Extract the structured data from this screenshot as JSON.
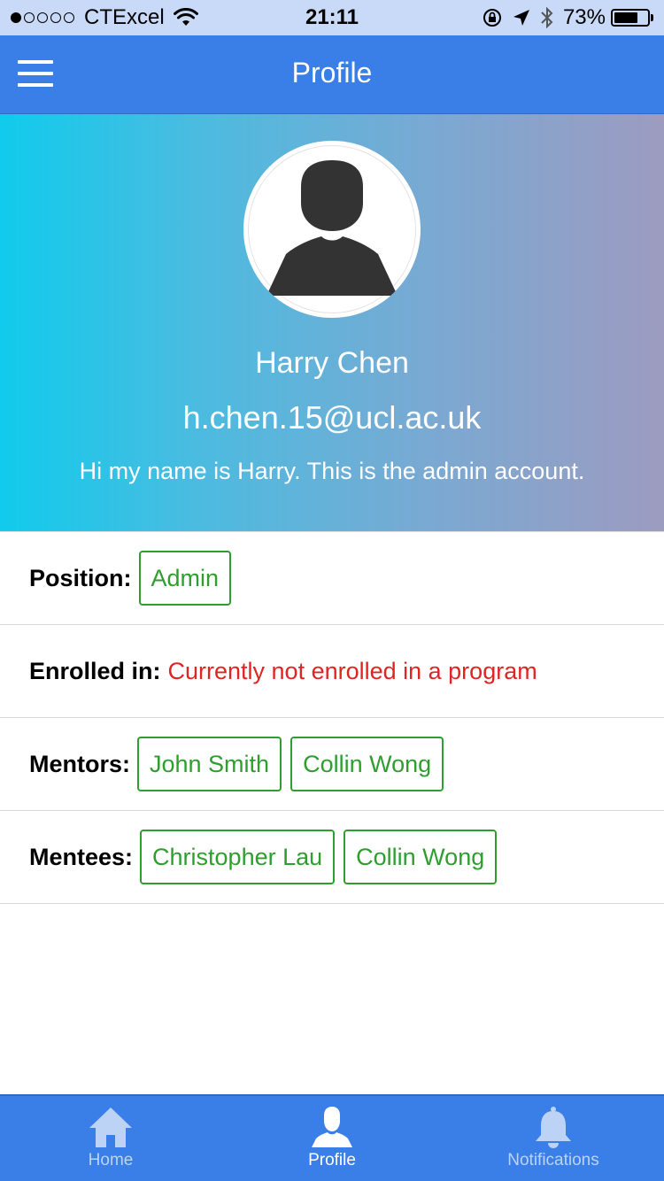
{
  "status_bar": {
    "carrier": "CTExcel",
    "time": "21:11",
    "battery_percent": "73%",
    "battery_level": 0.73,
    "signal_strength": 1,
    "signal_dots_total": 5
  },
  "header": {
    "title": "Profile",
    "menu_icon": "hamburger-menu-icon"
  },
  "profile": {
    "name": "Harry Chen",
    "email": "h.chen.15@ucl.ac.uk",
    "bio": "Hi my name is Harry. This is the admin account.",
    "avatar_icon": "default-user-avatar-icon"
  },
  "details": {
    "position": {
      "label": "Position:",
      "tags": [
        "Admin"
      ]
    },
    "enrolled": {
      "label": "Enrolled in:",
      "status": "Currently not enrolled in a program"
    },
    "mentors": {
      "label": "Mentors:",
      "tags": [
        "John Smith",
        "Collin Wong"
      ]
    },
    "mentees": {
      "label": "Mentees:",
      "tags": [
        "Christopher Lau",
        "Collin Wong"
      ]
    }
  },
  "tab_bar": {
    "items": [
      {
        "label": "Home",
        "icon": "home-icon",
        "active": false
      },
      {
        "label": "Profile",
        "icon": "person-icon",
        "active": true
      },
      {
        "label": "Notifications",
        "icon": "bell-icon",
        "active": false
      }
    ]
  },
  "colors": {
    "primary": "#3a7ee8",
    "tag_green": "#2e9e2e",
    "warning_red": "#e02424",
    "hero_gradient_start": "#10cbec",
    "hero_gradient_end": "#9d9bc0"
  }
}
